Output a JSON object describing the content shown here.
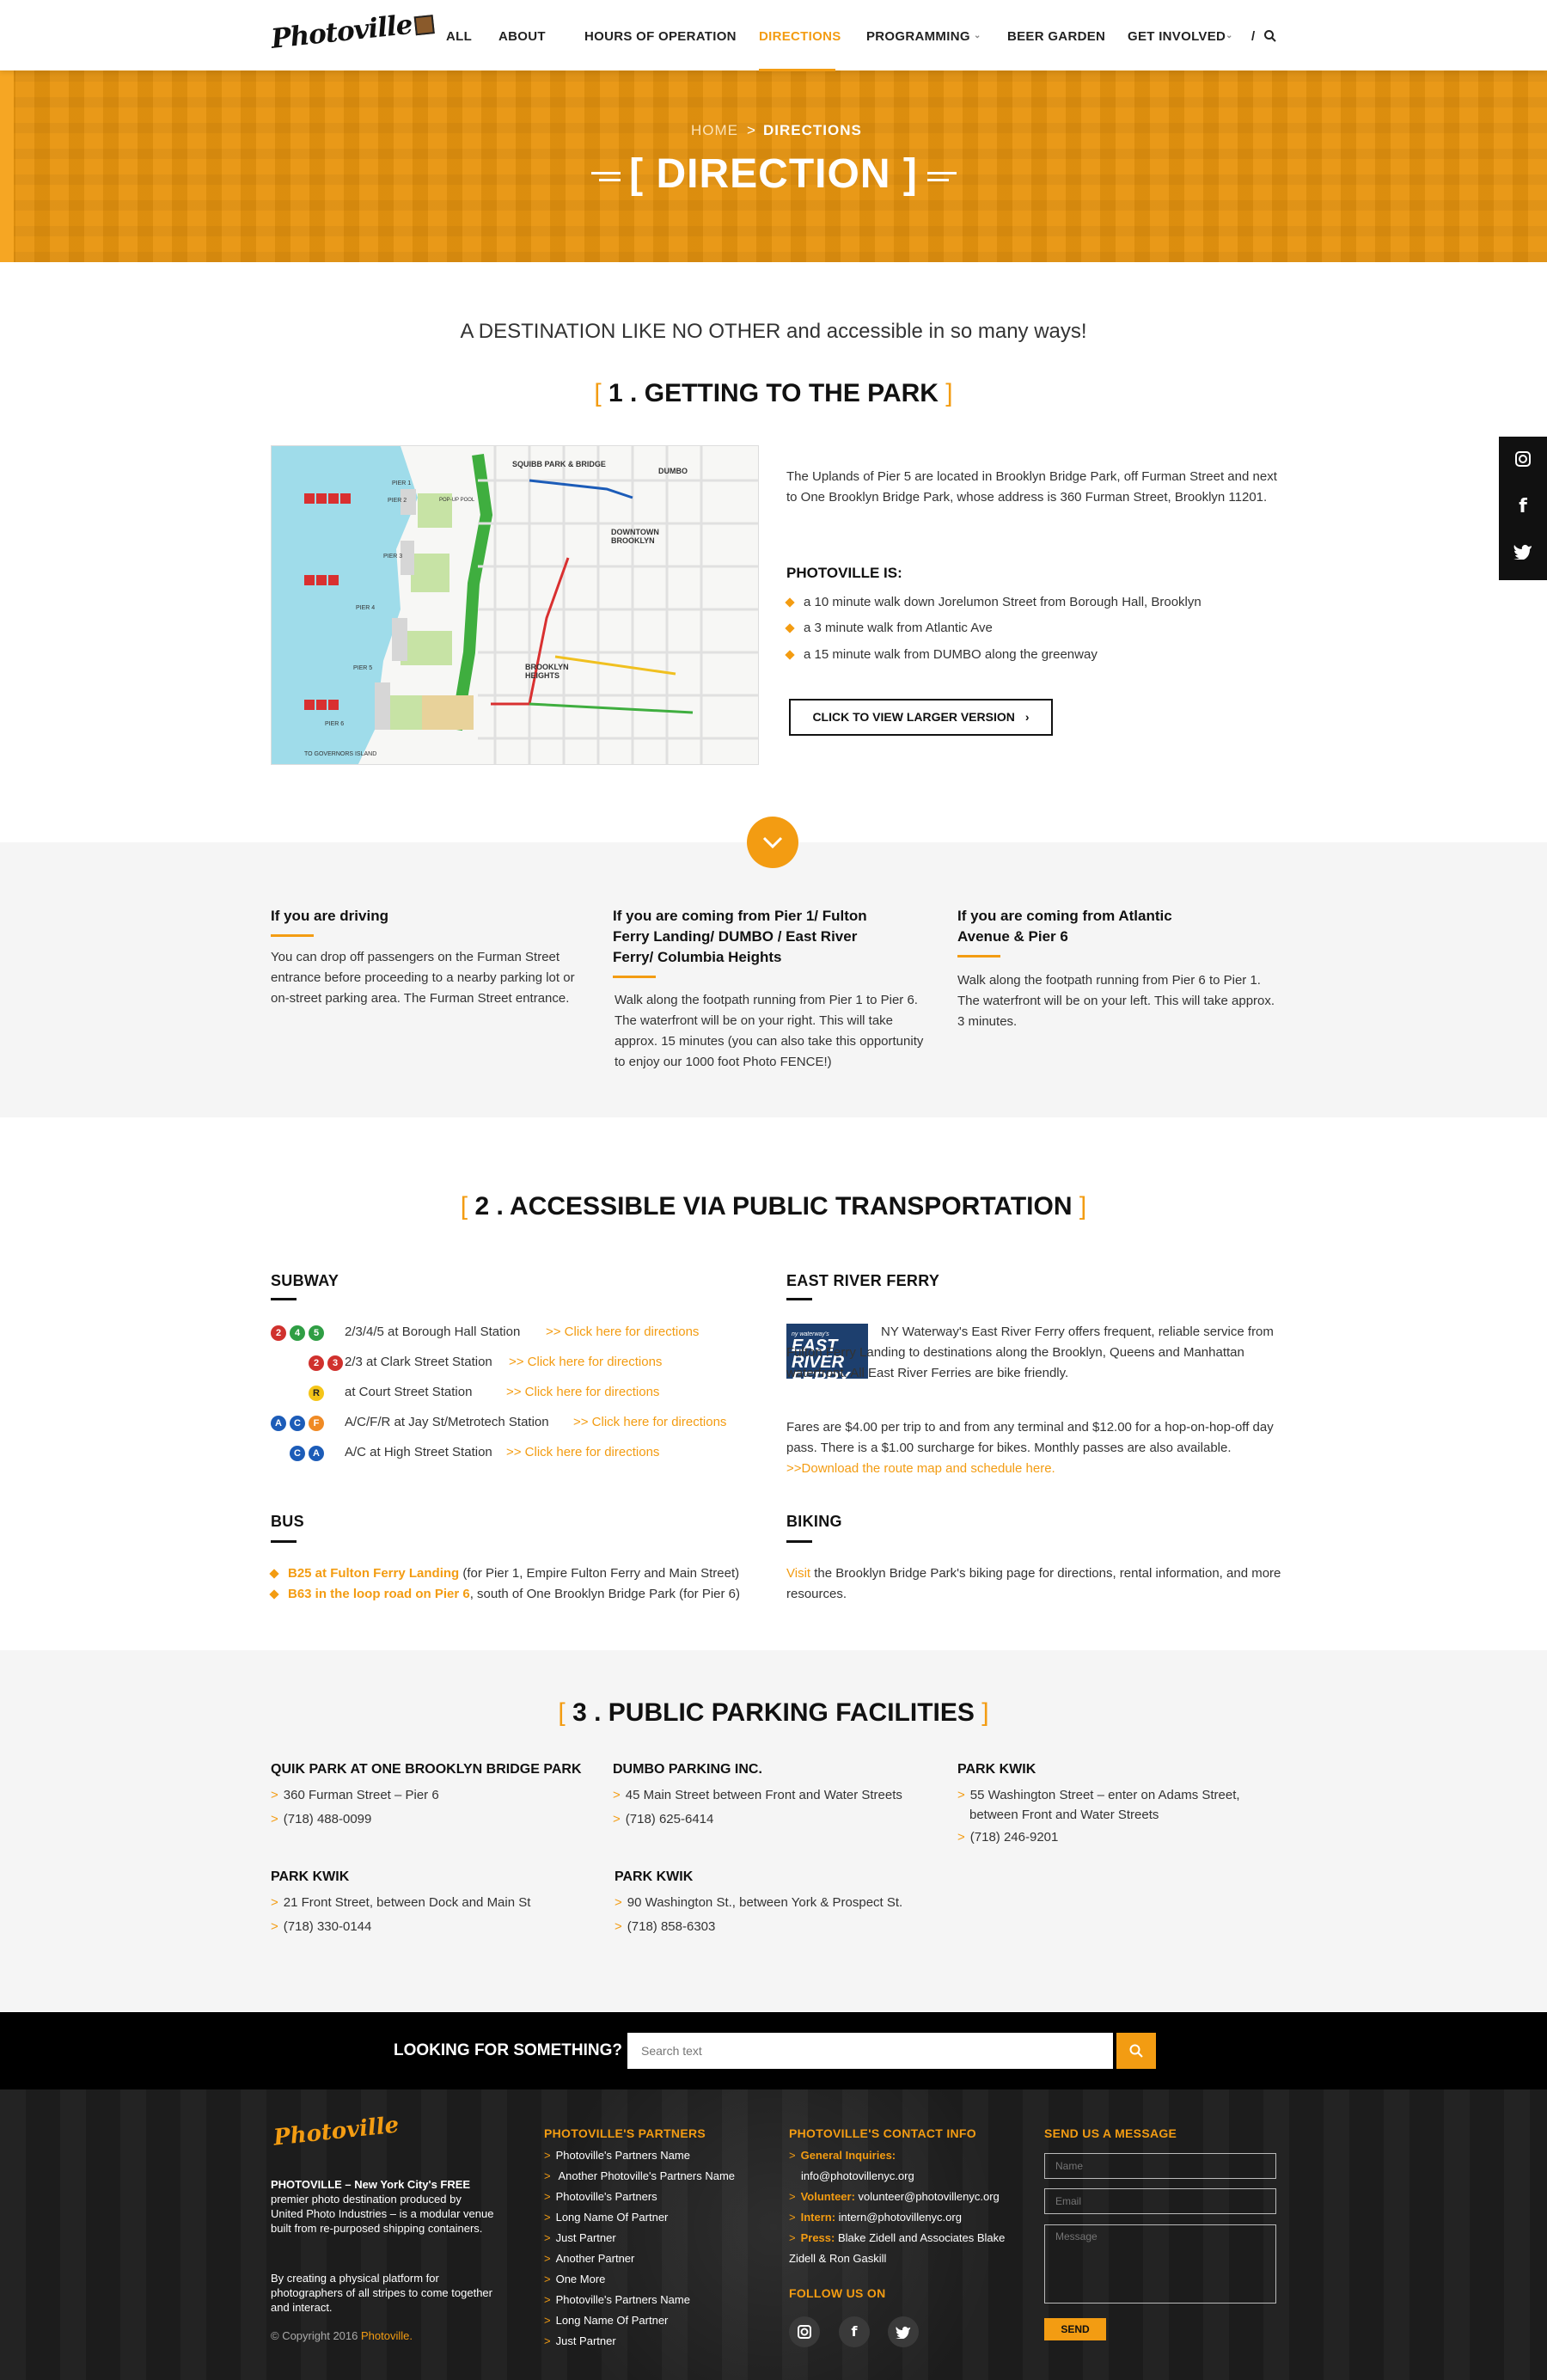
{
  "header": {
    "logo_text": "Photoville",
    "nav": [
      "ALL",
      "ABOUT",
      "HOURS OF OPERATION",
      "DIRECTIONS",
      "PROGRAMMING",
      "BEER GARDEN",
      "GET INVOLVED",
      "/"
    ],
    "active_nav": "DIRECTIONS"
  },
  "hero": {
    "breadcrumb_home": "HOME",
    "breadcrumb_sep": ">",
    "breadcrumb_current": "DIRECTIONS",
    "title": "[ DIRECTION ]"
  },
  "tagline": "A DESTINATION LIKE NO OTHER and accessible in so many ways!",
  "section1": {
    "title_open": "[",
    "title": " 1 . GETTING TO THE PARK ",
    "title_close": "]",
    "map_labels": [
      "SQUIBB PARK & BRIDGE",
      "DUMBO",
      "DOWNTOWN BROOKLYN",
      "BROOKLYN HEIGHTS",
      "PIER 1",
      "PIER 2",
      "PIER 3",
      "PIER 4",
      "PIER 5",
      "PIER 6",
      "POP-UP POOL",
      "TO GOVERNORS ISLAND"
    ],
    "address_text": "The Uplands of Pier 5 are located in Brooklyn Bridge Park, off Furman Street and next to One Brooklyn Bridge Park, whose address is 360 Furman Street, Brooklyn 11201.",
    "photoville_is": "PHOTOVILLE IS:",
    "bullets": [
      "a 10 minute walk down Jorelumon Street from Borough Hall, Brooklyn",
      "a 3 minute walk from Atlantic Ave",
      "a 15 minute walk from DUMBO along the greenway"
    ],
    "button": "CLICK TO VIEW LARGER VERSION"
  },
  "routes": [
    {
      "title": "If you are driving",
      "text": "You can drop off passengers on the Furman Street entrance before proceeding to a nearby parking lot or on-street parking area. The Furman Street entrance."
    },
    {
      "title": "If you are coming from Pier 1/ Fulton Ferry Landing/ DUMBO / East River Ferry/ Columbia Heights",
      "text": "Walk along the footpath running from Pier 1 to Pier 6. The waterfront will be on your right. This will take approx. 15 minutes (you can also take this opportunity to enjoy our 1000 foot Photo FENCE!)"
    },
    {
      "title": "If you are coming from Atlantic Avenue & Pier 6",
      "text": "Walk along the footpath running from Pier 6 to Pier 1. The waterfront will be on your left. This will take approx. 3 minutes."
    }
  ],
  "section2": {
    "title_open": "[",
    "title": " 2 . ACCESSIBLE VIA PUBLIC TRANSPORTATION ",
    "title_close": "]",
    "subway_title": "SUBWAY",
    "subway": [
      {
        "lines": [
          "2",
          "4",
          "5"
        ],
        "text": "2/3/4/5 at Borough Hall Station",
        "link": ">> Click here for directions"
      },
      {
        "lines": [
          "2",
          "3"
        ],
        "text": "2/3 at Clark Street Station",
        "link": ">> Click here for directions"
      },
      {
        "lines": [
          "R"
        ],
        "text": "at Court Street Station",
        "link": ">> Click here for directions"
      },
      {
        "lines": [
          "A",
          "C",
          "F"
        ],
        "text": "A/C/F/R at Jay St/Metrotech Station",
        "link": ">> Click here for directions"
      },
      {
        "lines": [
          "C",
          "A"
        ],
        "text": "A/C at High Street Station",
        "link": ">> Click here for directions"
      }
    ],
    "ferry_title": "EAST RIVER FERRY",
    "ferry_logo_small": "ny waterway's",
    "ferry_logo": [
      "EAST",
      "RIVER",
      "FERRY"
    ],
    "ferry_text": "NY Waterway's East River Ferry offers frequent, reliable service from Fulton Ferry Landing to destinations along the Brooklyn, Queens and Manhattan waterfront. All East River Ferries are bike friendly.",
    "ferry_fares": "Fares are $4.00 per trip to and from any terminal and $12.00 for a hop-on-hop-off day pass. There is a $1.00 surcharge for bikes. Monthly passes are also available.",
    "ferry_link": ">>Download the route map and schedule here.",
    "bus_title": "BUS",
    "bus": [
      {
        "link": "B25 at Fulton Ferry Landing",
        "text": " (for Pier 1, Empire Fulton Ferry and Main Street)"
      },
      {
        "link": "B63 in the loop road on Pier 6",
        "text": ", south of One Brooklyn Bridge Park (for Pier 6)"
      }
    ],
    "biking_title": "BIKING",
    "biking_link": "Visit",
    "biking_text": " the Brooklyn Bridge Park's biking page for directions, rental information, and more resources."
  },
  "section3": {
    "title_open": "[",
    "title": " 3 . PUBLIC PARKING FACILITIES ",
    "title_close": "]",
    "lots": [
      {
        "name": "QUIK PARK AT ONE BROOKLYN BRIDGE PARK",
        "address": "360 Furman Street – Pier 6",
        "phone": "(718) 488-0099"
      },
      {
        "name": "DUMBO PARKING INC.",
        "address": "45 Main Street between Front and Water Streets",
        "phone": "(718) 625-6414"
      },
      {
        "name": "PARK KWIK",
        "address": "55 Washington Street – enter on Adams Street, between Front and Water Streets",
        "phone": "(718) 246-9201"
      },
      {
        "name": "PARK KWIK",
        "address": "21 Front Street, between Dock and Main St",
        "phone": "(718) 330-0144"
      },
      {
        "name": "PARK KWIK",
        "address": "90 Washington St., between York & Prospect St.",
        "phone": "(718) 858-6303"
      }
    ]
  },
  "search": {
    "label": "LOOKING FOR SOMETHING?",
    "placeholder": "Search text"
  },
  "footer": {
    "logo_text": "Photoville",
    "about_bold": "PHOTOVILLE – New York City's FREE",
    "about": "premier photo destination produced by United Photo Industries – is a modular venue built from re-purposed shipping containers.",
    "about2": "By creating a physical platform for photographers of all stripes to come together and interact.",
    "copyright": "© Copyright 2016",
    "copyright_link": "Photoville.",
    "partners_title": "PHOTOVILLE'S PARTNERS",
    "partners": [
      "Photoville's Partners Name",
      "Another Photoville's Partners Name",
      "Photoville's Partners",
      "Long Name Of Partner",
      "Just Partner",
      "Another Partner",
      "One More",
      "Photoville's Partners Name",
      "Long Name Of Partner",
      "Just Partner"
    ],
    "contact_title": "PHOTOVILLE'S CONTACT INFO",
    "contacts": [
      {
        "label": "General Inquiries:",
        "value": "info@photovillenyc.org"
      },
      {
        "label": "Volunteer:",
        "value": "volunteer@photovillenyc.org"
      },
      {
        "label": "Intern:",
        "value": "intern@photovillenyc.org"
      },
      {
        "label": "Press:",
        "value": "Blake Zidell and Associates Blake Zidell & Ron Gaskill"
      }
    ],
    "follow_title": "FOLLOW US ON",
    "message_title": "SEND US A MESSAGE",
    "name_placeholder": "Name",
    "email_placeholder": "Email",
    "message_placeholder": "Message",
    "send": "SEND"
  },
  "colors": {
    "accent": "#f39c12",
    "dark": "#111111",
    "band": "#f5f5f5"
  },
  "icons": [
    "search-icon",
    "instagram-icon",
    "facebook-icon",
    "twitter-icon",
    "chevron-down-icon",
    "chevron-right-icon"
  ]
}
